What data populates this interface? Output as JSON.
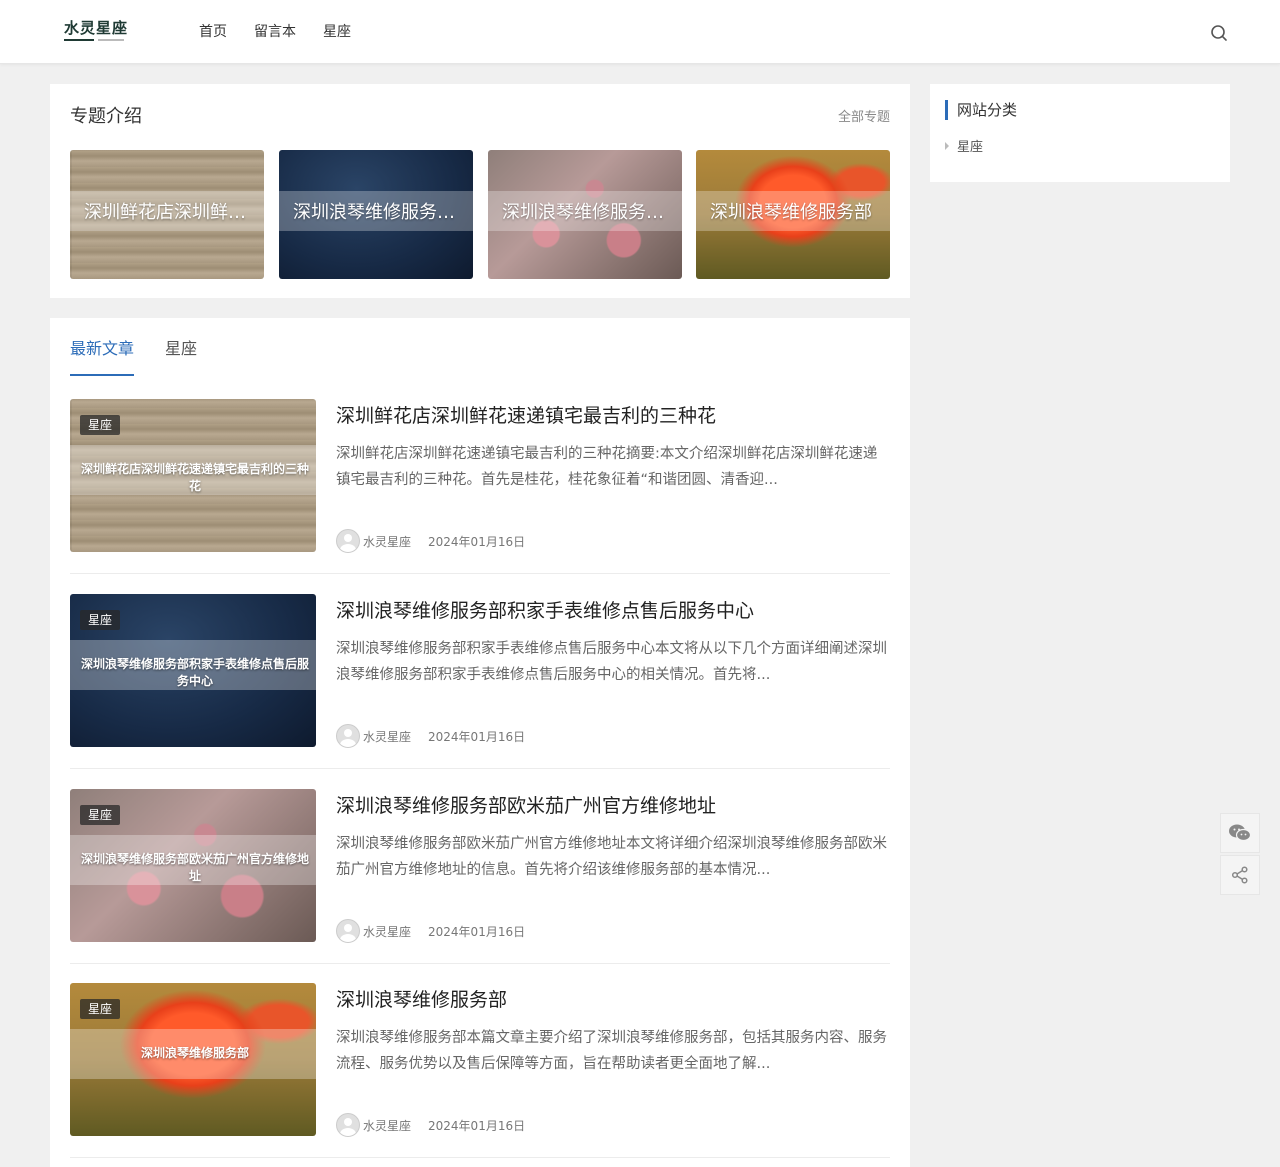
{
  "header": {
    "logo_text": "水灵星座",
    "nav": [
      "首页",
      "留言本",
      "星座"
    ]
  },
  "topics": {
    "title": "专题介绍",
    "more": "全部专题",
    "cards": [
      {
        "title": "深圳鲜花店深圳鲜花速递镇宅最吉利的三种花",
        "image": "wood-rosemary"
      },
      {
        "title": "深圳浪琴维修服务部积家手表维修点售后服务中心",
        "image": "denim-seatbelt"
      },
      {
        "title": "深圳浪琴维修服务部欧米茄广州官方维修地址",
        "image": "pink-blossom"
      },
      {
        "title": "深圳浪琴维修服务部",
        "image": "red-poppy"
      }
    ]
  },
  "tabs": [
    "最新文章",
    "星座"
  ],
  "posts": [
    {
      "category": "星座",
      "thumb_caption": "深圳鲜花店深圳鲜花速递镇宅最吉利的三种花",
      "title": "深圳鲜花店深圳鲜花速递镇宅最吉利的三种花",
      "excerpt": "深圳鲜花店深圳鲜花速递镇宅最吉利的三种花摘要:本文介绍深圳鲜花店深圳鲜花速递镇宅最吉利的三种花。首先是桂花，桂花象征着“和谐团圆、清香迎...",
      "author": "水灵星座",
      "date": "2024年01月16日"
    },
    {
      "category": "星座",
      "thumb_caption": "深圳浪琴维修服务部积家手表维修点售后服务中心",
      "title": "深圳浪琴维修服务部积家手表维修点售后服务中心",
      "excerpt": "深圳浪琴维修服务部积家手表维修点售后服务中心本文将从以下几个方面详细阐述深圳浪琴维修服务部积家手表维修点售后服务中心的相关情况。首先将...",
      "author": "水灵星座",
      "date": "2024年01月16日"
    },
    {
      "category": "星座",
      "thumb_caption": "深圳浪琴维修服务部欧米茄广州官方维修地址",
      "title": "深圳浪琴维修服务部欧米茄广州官方维修地址",
      "excerpt": "深圳浪琴维修服务部欧米茄广州官方维修地址本文将详细介绍深圳浪琴维修服务部欧米茄广州官方维修地址的信息。首先将介绍该维修服务部的基本情况...",
      "author": "水灵星座",
      "date": "2024年01月16日"
    },
    {
      "category": "星座",
      "thumb_caption": "深圳浪琴维修服务部",
      "title": "深圳浪琴维修服务部",
      "excerpt": "深圳浪琴维修服务部本篇文章主要介绍了深圳浪琴维修服务部，包括其服务内容、服务流程、服务优势以及售后保障等方面，旨在帮助读者更全面地了解...",
      "author": "水灵星座",
      "date": "2024年01月16日"
    }
  ],
  "sidebar": {
    "title": "网站分类",
    "items": [
      "星座"
    ]
  },
  "colors": {
    "accent": "#2c6cb8",
    "background": "#f0f0f0"
  },
  "icons": [
    "search-icon",
    "wechat-icon",
    "share-icon"
  ]
}
